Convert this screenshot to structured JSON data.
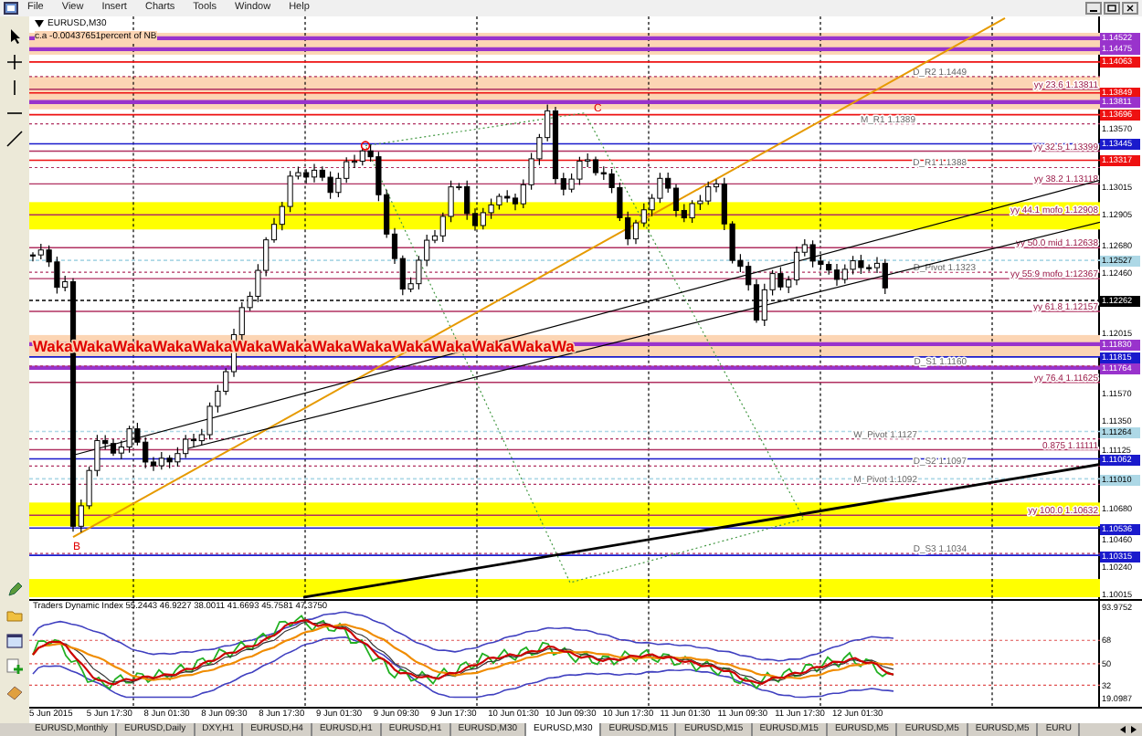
{
  "menu": [
    "File",
    "View",
    "Insert",
    "Charts",
    "Tools",
    "Window",
    "Help"
  ],
  "chart": {
    "title": "EURUSD,M30",
    "subtitle": "c.a -0.00437651percent of NB",
    "banner": "WakaWakaWakaWakaWakaWakaWakaWakaWakaWakaWakaWakaWakaWa",
    "marks": [
      "C",
      "B"
    ],
    "levels": [
      {
        "text": "D_R2 1.1449",
        "kind": "pivot"
      },
      {
        "text": "yy 23.6 1.13811",
        "kind": "fib"
      },
      {
        "text": "M_R1 1.1389",
        "kind": "pivot"
      },
      {
        "text": "yy 32.5 1.13399",
        "kind": "fib"
      },
      {
        "text": "D_R1 1.1388",
        "kind": "pivot"
      },
      {
        "text": "yy 38.2 1.13118",
        "kind": "fib"
      },
      {
        "text": "yy 44.1 mofo 1.12908",
        "kind": "fib"
      },
      {
        "text": "yy 50.0 mid 1.12638",
        "kind": "fib"
      },
      {
        "text": "D_Pivot 1.1323",
        "kind": "pivot"
      },
      {
        "text": "yy 55.9 mofo 1.12367",
        "kind": "fib"
      },
      {
        "text": "yy 61.8 1.12157",
        "kind": "fib"
      },
      {
        "text": "D_S1 1.1160",
        "kind": "pivot"
      },
      {
        "text": "yy 76.4 1.11625",
        "kind": "fib"
      },
      {
        "text": "W_Pivot 1.1127",
        "kind": "pivot"
      },
      {
        "text": "0.875 1.11111",
        "kind": "fib"
      },
      {
        "text": "D_S2 1.1097",
        "kind": "pivot"
      },
      {
        "text": "M_Pivot 1.1092",
        "kind": "pivot"
      },
      {
        "text": "yy 100.0 1.10632",
        "kind": "fib"
      },
      {
        "text": "D_S3 1.1034",
        "kind": "pivot"
      }
    ],
    "price_axis": [
      {
        "text": "1.14522",
        "kind": "tag",
        "color": "#9933cc"
      },
      {
        "text": "1.14475",
        "kind": "tag",
        "color": "#9933cc"
      },
      {
        "text": "1.14063",
        "kind": "tag",
        "color": "#ee1111"
      },
      {
        "text": "1.13849",
        "kind": "tag",
        "color": "#ee1111"
      },
      {
        "text": "1.13811",
        "kind": "tag",
        "color": "#9933cc"
      },
      {
        "text": "1.13696",
        "kind": "tag",
        "color": "#ee1111"
      },
      {
        "text": "1.13570",
        "kind": "tick"
      },
      {
        "text": "1.13445",
        "kind": "tag",
        "color": "#1a1acc"
      },
      {
        "text": "1.13317",
        "kind": "tag",
        "color": "#ee1111"
      },
      {
        "text": "1.13015",
        "kind": "tick"
      },
      {
        "text": "1.12905",
        "kind": "tick"
      },
      {
        "text": "1.12680",
        "kind": "tick"
      },
      {
        "text": "1.12527",
        "kind": "tag",
        "color": "#add8e6"
      },
      {
        "text": "1.12460",
        "kind": "tick"
      },
      {
        "text": "1.12262",
        "kind": "tag",
        "color": "#000000"
      },
      {
        "text": "1.12015",
        "kind": "tick"
      },
      {
        "text": "1.11830",
        "kind": "tag",
        "color": "#9933cc"
      },
      {
        "text": "1.11815",
        "kind": "tag",
        "color": "#1a1acc"
      },
      {
        "text": "1.11764",
        "kind": "tag",
        "color": "#9933cc"
      },
      {
        "text": "1.11570",
        "kind": "tick"
      },
      {
        "text": "1.11350",
        "kind": "tick"
      },
      {
        "text": "1.11264",
        "kind": "tag",
        "color": "#add8e6"
      },
      {
        "text": "1.11125",
        "kind": "tick"
      },
      {
        "text": "1.11062",
        "kind": "tag",
        "color": "#1a1acc"
      },
      {
        "text": "1.11010",
        "kind": "tag",
        "color": "#add8e6"
      },
      {
        "text": "1.10680",
        "kind": "tick"
      },
      {
        "text": "1.10536",
        "kind": "tag",
        "color": "#1a1acc"
      },
      {
        "text": "1.10460",
        "kind": "tick"
      },
      {
        "text": "1.10315",
        "kind": "tag",
        "color": "#1a1acc"
      },
      {
        "text": "1.10240",
        "kind": "tick"
      },
      {
        "text": "1.10015",
        "kind": "tick"
      }
    ]
  },
  "indicator": {
    "title": "Traders Dynamic Index 55.2443 46.9227 38.0011 41.6693 45.7581 47.3750",
    "axis": [
      "93.9752",
      "68",
      "50",
      "32",
      "19.0987"
    ]
  },
  "time_axis": [
    "5 Jun 2015",
    "5 Jun 17:30",
    "8 Jun 01:30",
    "8 Jun 09:30",
    "8 Jun 17:30",
    "9 Jun 01:30",
    "9 Jun 09:30",
    "9 Jun 17:30",
    "10 Jun 01:30",
    "10 Jun 09:30",
    "10 Jun 17:30",
    "11 Jun 01:30",
    "11 Jun 09:30",
    "11 Jun 17:30",
    "12 Jun 01:30"
  ],
  "tabs": [
    {
      "label": "EURUSD,Monthly",
      "selected": false
    },
    {
      "label": "EURUSD,Daily",
      "selected": false
    },
    {
      "label": "DXY,H1",
      "selected": false
    },
    {
      "label": "EURUSD,H4",
      "selected": false
    },
    {
      "label": "EURUSD,H1",
      "selected": false
    },
    {
      "label": "EURUSD,H1",
      "selected": false
    },
    {
      "label": "EURUSD,M30",
      "selected": false
    },
    {
      "label": "EURUSD,M30",
      "selected": true
    },
    {
      "label": "EURUSD,M15",
      "selected": false
    },
    {
      "label": "EURUSD,M15",
      "selected": false
    },
    {
      "label": "EURUSD,M15",
      "selected": false
    },
    {
      "label": "EURUSD,M5",
      "selected": false
    },
    {
      "label": "EURUSD,M5",
      "selected": false
    },
    {
      "label": "EURUSD,M5",
      "selected": false
    },
    {
      "label": "EURU",
      "selected": false
    }
  ]
}
